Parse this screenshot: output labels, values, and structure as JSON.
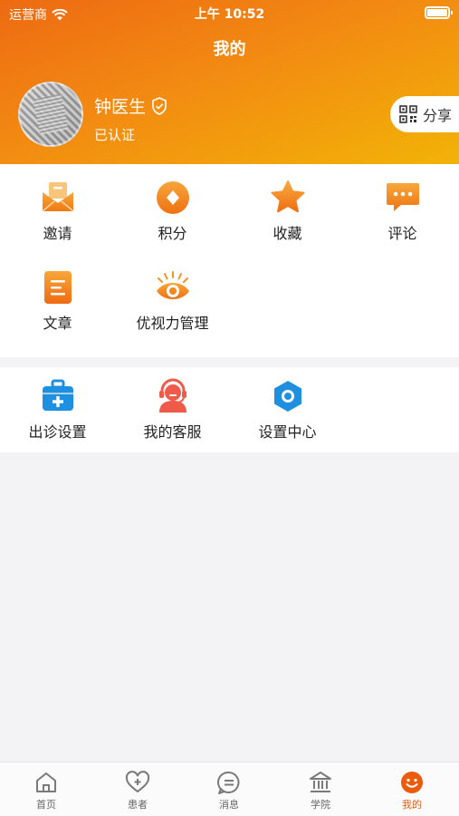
{
  "status_bar": {
    "carrier": "运营商",
    "time": "上午 10:52"
  },
  "header": {
    "title": "我的"
  },
  "profile": {
    "name": "钟医生",
    "verified_label": "已认证",
    "share_label": "分享"
  },
  "menu_primary": [
    {
      "label": "邀请",
      "icon": "invite-envelope-icon"
    },
    {
      "label": "积分",
      "icon": "points-coin-icon"
    },
    {
      "label": "收藏",
      "icon": "favorite-star-icon"
    },
    {
      "label": "评论",
      "icon": "comment-bubble-icon"
    },
    {
      "label": "文章",
      "icon": "article-doc-icon"
    },
    {
      "label": "优视力管理",
      "icon": "eye-icon"
    }
  ],
  "menu_secondary": [
    {
      "label": "出诊设置",
      "icon": "medical-kit-icon"
    },
    {
      "label": "我的客服",
      "icon": "customer-service-icon"
    },
    {
      "label": "设置中心",
      "icon": "settings-hexagon-icon"
    }
  ],
  "tabbar": [
    {
      "label": "首页",
      "icon": "home-icon"
    },
    {
      "label": "患者",
      "icon": "patient-heart-icon"
    },
    {
      "label": "消息",
      "icon": "message-icon"
    },
    {
      "label": "学院",
      "icon": "academy-icon"
    },
    {
      "label": "我的",
      "icon": "profile-smile-icon",
      "active": true
    }
  ],
  "colors": {
    "accent": "#ea5b0c",
    "header_start": "#ee6a12",
    "header_end": "#f2b307",
    "blue": "#1f8fe0",
    "red": "#ef5a4a"
  }
}
